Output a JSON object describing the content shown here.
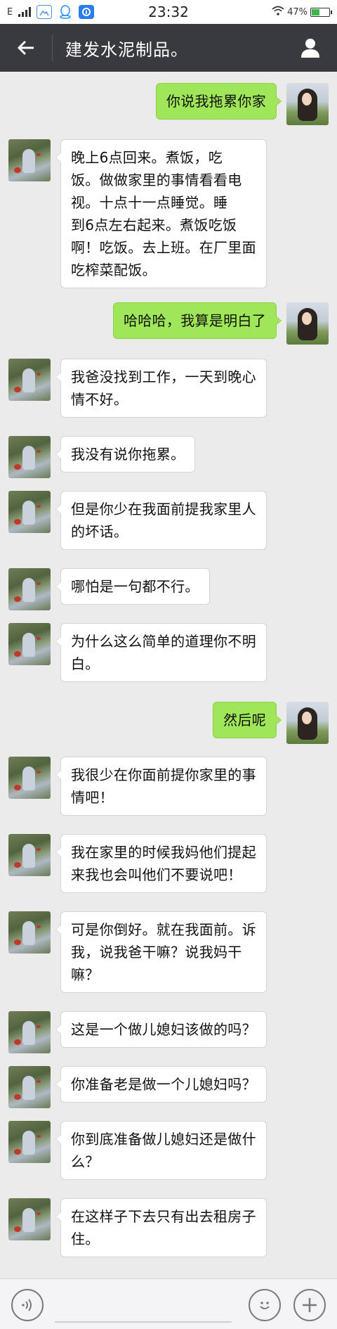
{
  "status_bar": {
    "network": "E",
    "time": "23:32",
    "battery": "47%",
    "battery_level": 0.47
  },
  "header": {
    "title": "建发水泥制品。"
  },
  "messages": [
    {
      "from": "me",
      "text": "你说我拖累你家"
    },
    {
      "from": "friend",
      "lines": [
        "晚上6点回来。煮饭，吃",
        "饭。做做家里的事情看看电",
        "视。十点十一点睡觉。睡",
        "到6点左右起来。煮饭吃饭",
        "啊！吃饭。去上班。在厂里面",
        "吃榨菜配饭。"
      ]
    },
    {
      "from": "me",
      "text": "哈哈哈，我算是明白了"
    },
    {
      "from": "friend",
      "lines": [
        "我爸没找到工作，一天到晚心",
        "情不好。"
      ]
    },
    {
      "from": "friend",
      "lines": [
        "我没有说你拖累。"
      ]
    },
    {
      "from": "friend",
      "lines": [
        "但是你少在我面前提我家里人",
        "的坏话。"
      ]
    },
    {
      "from": "friend",
      "lines": [
        "哪怕是一句都不行。"
      ]
    },
    {
      "from": "friend",
      "lines": [
        "为什么这么简单的道理你不明",
        "白。"
      ]
    },
    {
      "from": "me",
      "text": "然后呢"
    },
    {
      "from": "friend",
      "lines": [
        "我很少在你面前提你家里的事",
        "情吧！"
      ]
    },
    {
      "from": "friend",
      "lines": [
        "我在家里的时候我妈他们提起",
        "来我也会叫他们不要说吧！"
      ]
    },
    {
      "from": "friend",
      "lines": [
        "可是你倒好。就在我面前。诉",
        "我，说我爸干嘛？说我妈干",
        "嘛？"
      ]
    },
    {
      "from": "friend",
      "lines": [
        "这是一个做儿媳妇该做的吗？"
      ]
    },
    {
      "from": "friend",
      "lines": [
        "你准备老是做一个儿媳妇吗？"
      ]
    },
    {
      "from": "friend",
      "lines": [
        "你到底准备做儿媳妇还是做什",
        "么？"
      ]
    },
    {
      "from": "friend",
      "lines": [
        "在这样子下去只有出去租房子",
        "住。"
      ]
    }
  ],
  "icons": {
    "back": "arrow-left-icon",
    "profile": "person-icon",
    "voice": "voice-icon",
    "emoji": "emoji-icon",
    "more": "plus-icon"
  },
  "colors": {
    "titlebar": "#393a3f",
    "outgoing_bubble": "#9fe658",
    "incoming_bubble": "#ffffff",
    "background": "#ebebeb"
  }
}
